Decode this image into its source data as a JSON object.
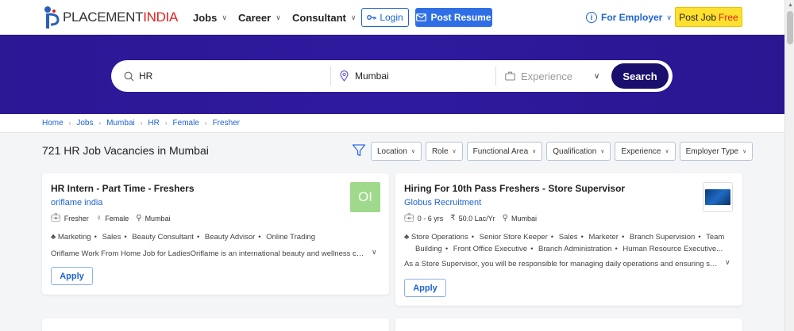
{
  "brand": {
    "logo_part1": "PLACEMENT",
    "logo_part2": "INDIA",
    "accent": "#e02020",
    "primary": "#2c1795"
  },
  "nav": {
    "jobs": "Jobs",
    "career": "Career",
    "consultant": "Consultant",
    "login": "Login",
    "post_resume": "Post Resume",
    "for_employer": "For Employer",
    "post_job": "Post Job",
    "post_job_free": "Free"
  },
  "search": {
    "keyword": "HR",
    "location": "Mumbai",
    "experience_placeholder": "Experience",
    "search_label": "Search"
  },
  "breadcrumb": [
    "Home",
    "Jobs",
    "Mumbai",
    "HR",
    "Female",
    "Fresher"
  ],
  "results": {
    "title": "721 HR Job Vacancies in Mumbai"
  },
  "filters": [
    "Location",
    "Role",
    "Functional Area",
    "Qualification",
    "Experience",
    "Employer Type"
  ],
  "jobs": [
    {
      "title": "HR Intern - Part Time - Freshers",
      "company": "oriflame india",
      "logo_text": "OI",
      "meta": [
        "Fresher",
        "Female",
        "Mumbai"
      ],
      "skills": [
        "Marketing",
        "Sales",
        "Beauty Consultant",
        "Beauty Advisor",
        "Online Trading"
      ],
      "description": "Oriflame Work From Home Job for LadiesOriflame is an international beauty and wellness company",
      "apply": "Apply"
    },
    {
      "title": "Hiring For 10th Pass Freshers - Store Supervisor",
      "company": "Globus Recruitment",
      "meta": [
        "0 - 6 yrs",
        "50.0 Lac/Yr",
        "Mumbai"
      ],
      "skills_line1": [
        "Store Operations",
        "Senior Store Keeper",
        "Sales",
        "Marketer",
        "Branch Supervision",
        "Team"
      ],
      "skills_line2": [
        "Building",
        "Front Office Executive",
        "Branch Administration",
        "Human Resource Executive..."
      ],
      "description": "As a Store Supervisor, you will be responsible for managing daily operations and ensuring smooth functioning",
      "apply": "Apply"
    }
  ]
}
